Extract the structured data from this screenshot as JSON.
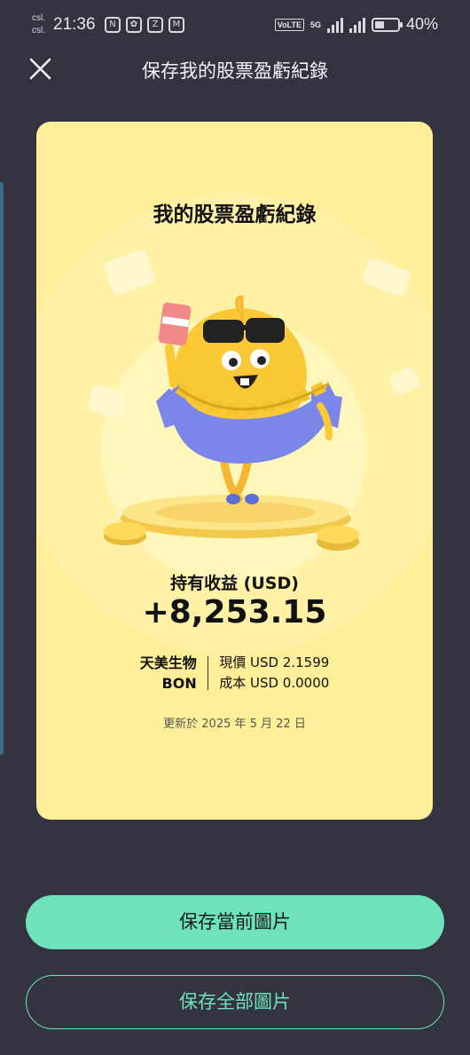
{
  "status_bar": {
    "carrier_1": "csl.",
    "carrier_2": "csl.",
    "time": "21:36",
    "network": "5G",
    "volte": "VoLTE",
    "battery": "40%"
  },
  "header": {
    "title": "保存我的股票盈虧紀錄",
    "close_icon": "close-icon"
  },
  "card": {
    "title": "我的股票盈虧紀錄",
    "illustration": "mascot-with-sunglasses-and-gold-chain",
    "holding_label": "持有收益 (USD)",
    "holding_value": "+8,253.15",
    "stock_name": "天美生物",
    "stock_symbol": "BON",
    "current_price": "現價 USD 2.1599",
    "cost": "成本 USD 0.0000",
    "updated": "更新於 2025 年 5 月 22 日"
  },
  "buttons": {
    "save_current": "保存當前圖片",
    "save_all": "保存全部圖片"
  },
  "colors": {
    "background": "#33343f",
    "card": "#ffef99",
    "accent": "#6ee3b9"
  }
}
